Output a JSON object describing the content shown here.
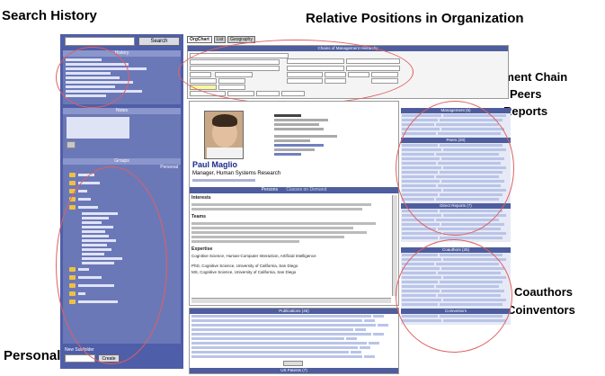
{
  "callouts": {
    "search_history": "Search History",
    "relative_positions": "Relative Positions in Organization",
    "management_chain": "Management Chain",
    "peers": "Peers",
    "reports": "Reports",
    "coauthors": "Coauthors",
    "coinventors": "Coinventors",
    "personal_groups": "Personal Groups"
  },
  "left": {
    "search_button": "Search",
    "history_header": "History",
    "notes_header": "Notes",
    "groups_header": "Groups",
    "groups_tab": "Personal",
    "new_subfolder_label": "New Subfolder",
    "create_button": "Create"
  },
  "tabs": {
    "org_chart": "OrgChart",
    "list": "List",
    "geography": "Geography"
  },
  "org_header": "Chains of Management Hierarchy",
  "profile": {
    "name": "Paul Maglio",
    "title": "Manager, Human Systems Research",
    "tabs": {
      "persons": "Persons",
      "classes": "Classes on Demand"
    },
    "interests_label": "Interests",
    "teams_label": "Teams",
    "expertise_label": "Expertise",
    "expertise_text": "Cognitive Science, Human-Computer Interaction, Artificial Intelligence",
    "ed1": "PhD, Cognitive Science, University of California, San Diego",
    "ed2": "MS, Cognitive Science, University of California, San Diego"
  },
  "publications_header": "Publications (46)",
  "patents_header": "US Patents (7)",
  "right": {
    "management_header": "Management (5)",
    "peers_header": "Peers (20)",
    "reports_header": "Direct Reports (7)",
    "coauthors_header": "Coauthors (25)",
    "coinventors_header": "Coinventors"
  }
}
